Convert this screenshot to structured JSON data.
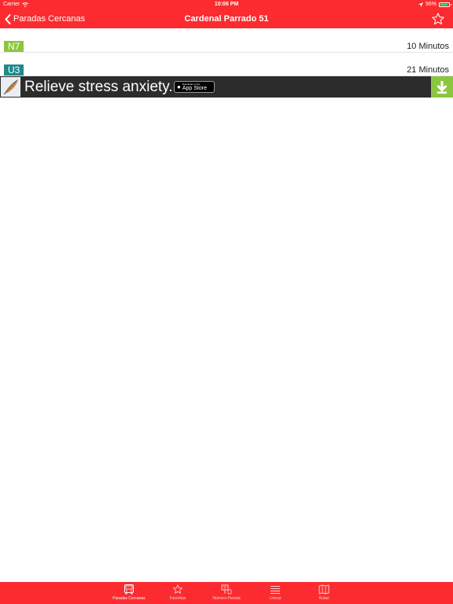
{
  "status_bar": {
    "carrier": "Carrier",
    "time": "10:06 PM",
    "battery": "96%"
  },
  "nav": {
    "back_label": "Paradas Cercanas",
    "title": "Cardenal Parrado 51"
  },
  "arrivals": [
    {
      "line": "N7",
      "minutes": "10 Minutos",
      "color": "#8cc63f"
    },
    {
      "line": "U3",
      "minutes": "21 Minutos",
      "color": "#1f8a8c"
    }
  ],
  "ad": {
    "text": "Relieve stress anxiety.",
    "store_small": "Download on the",
    "store_big": "App Store"
  },
  "tabs": [
    {
      "label": "Paradas Cercanas",
      "icon": "bus-icon",
      "active": true
    },
    {
      "label": "Favoritas",
      "icon": "star-icon",
      "active": false
    },
    {
      "label": "Número Parada",
      "icon": "stop-number-icon",
      "active": false
    },
    {
      "label": "Líneas",
      "icon": "list-icon",
      "active": false
    },
    {
      "label": "Rutas",
      "icon": "map-icon",
      "active": false
    }
  ],
  "colors": {
    "brand_red": "#fb2b2f",
    "ad_bg": "#2c2c2c",
    "ad_download": "#8cc63f"
  }
}
